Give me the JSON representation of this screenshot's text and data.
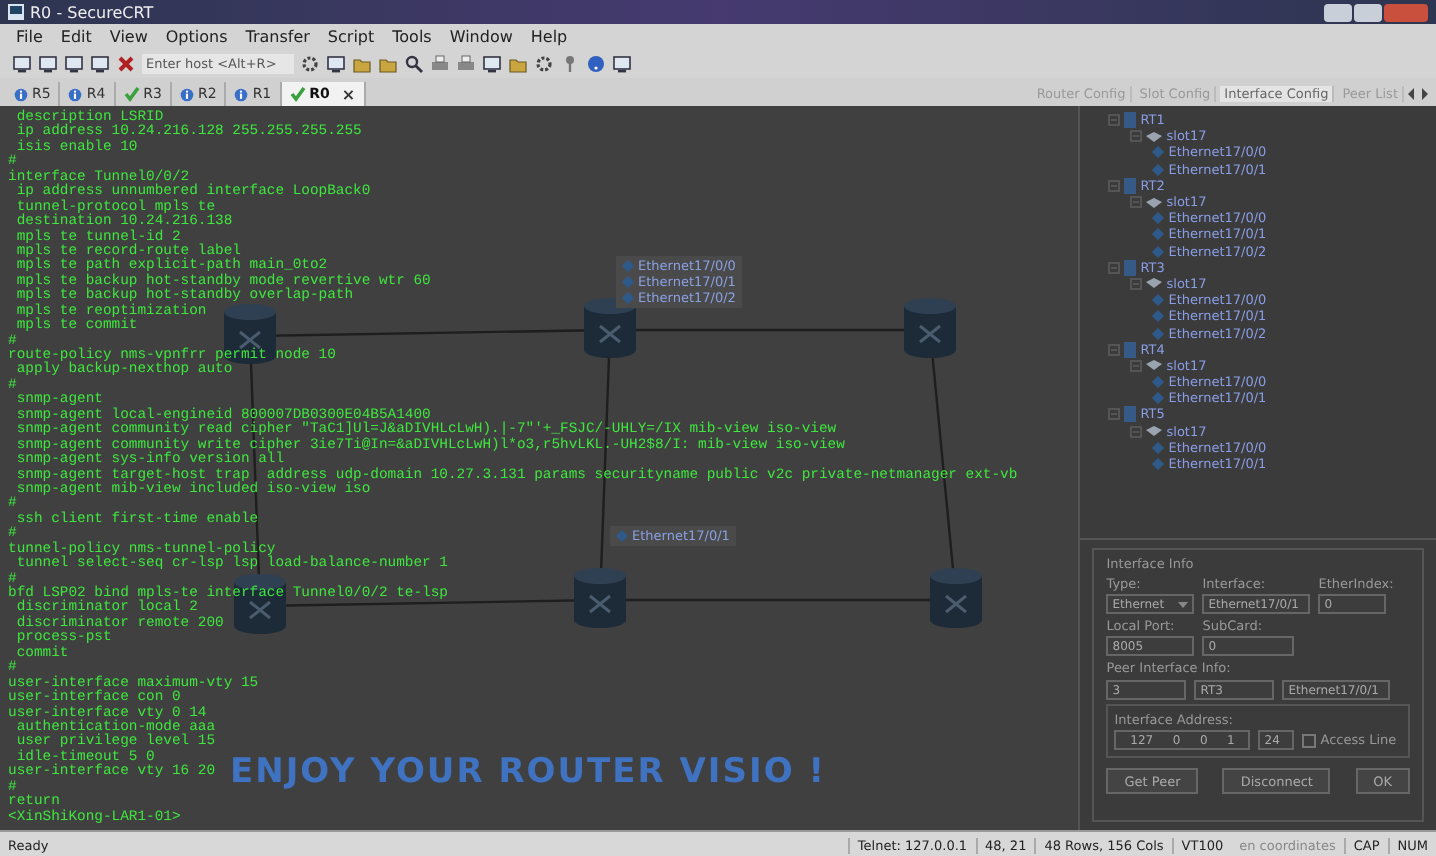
{
  "window": {
    "title": "R0 - SecureCRT"
  },
  "menu": [
    "File",
    "Edit",
    "View",
    "Options",
    "Transfer",
    "Script",
    "Tools",
    "Window",
    "Help"
  ],
  "toolbar": {
    "host_field": {
      "placeholder": "Enter host <Alt+R>"
    }
  },
  "session_tabs": [
    {
      "label": "R5",
      "kind": "info",
      "selected": false
    },
    {
      "label": "R4",
      "kind": "info",
      "selected": false
    },
    {
      "label": "R3",
      "kind": "check",
      "selected": false
    },
    {
      "label": "R2",
      "kind": "info",
      "selected": false
    },
    {
      "label": "R1",
      "kind": "info",
      "selected": false
    },
    {
      "label": "R0",
      "kind": "check",
      "selected": true
    }
  ],
  "close_tab": "×",
  "panel_tabs": [
    {
      "label": "Router Config",
      "selected": false
    },
    {
      "label": "Slot Config",
      "selected": false
    },
    {
      "label": "Interface Config",
      "selected": true
    },
    {
      "label": "Peer List",
      "selected": false
    }
  ],
  "terminal": {
    "lines": [
      " description LSRID",
      " ip address 10.24.216.128 255.255.255.255",
      " isis enable 10",
      "#",
      "interface Tunnel0/0/2",
      " ip address unnumbered interface LoopBack0",
      " tunnel-protocol mpls te",
      " destination 10.24.216.138",
      " mpls te tunnel-id 2",
      " mpls te record-route label",
      " mpls te path explicit-path main_0to2",
      " mpls te backup hot-standby mode revertive wtr 60",
      " mpls te backup hot-standby overlap-path",
      " mpls te reoptimization",
      " mpls te commit",
      "#",
      "route-policy nms-vpnfrr permit node 10",
      " apply backup-nexthop auto",
      "#",
      " snmp-agent",
      " snmp-agent local-engineid 800007DB0300E04B5A1400",
      " snmp-agent community read cipher \"TaC1]Ul=J&aDIVHLcLwH).|-7\"'+_FSJC/-UHLY=/IX mib-view iso-view",
      " snmp-agent community write cipher 3ie7Ti@In=&aDIVHLcLwH)l*o3,r5hvLKL.-UH2$8/I: mib-view iso-view",
      " snmp-agent sys-info version all",
      " snmp-agent target-host trap  address udp-domain 10.27.3.131 params securityname public v2c private-netmanager ext-vb",
      " snmp-agent mib-view included iso-view iso",
      "#",
      " ssh client first-time enable",
      "#",
      "tunnel-policy nms-tunnel-policy",
      " tunnel select-seq cr-lsp lsp load-balance-number 1",
      "#",
      "bfd LSP02 bind mpls-te interface Tunnel0/0/2 te-lsp",
      " discriminator local 2",
      " discriminator remote 200",
      " process-pst",
      " commit",
      "#",
      "user-interface maximum-vty 15",
      "user-interface con 0",
      "user-interface vty 0 14",
      " authentication-mode aaa",
      " user privilege level 15",
      " idle-timeout 5 0",
      "user-interface vty 16 20",
      "#",
      "return",
      "<XinShiKong-LAR1-01>"
    ]
  },
  "diagram": {
    "port_popups": [
      {
        "ports": [
          "Ethernet17/0/0",
          "Ethernet17/0/1",
          "Ethernet17/0/2"
        ]
      },
      {
        "ports": [
          "Ethernet17/0/1"
        ]
      }
    ],
    "banner": "ENJOY YOUR ROUTER VISIO !"
  },
  "device_tree": [
    {
      "label": "RT1",
      "children": [
        {
          "label": "slot17",
          "children": [
            {
              "label": "Ethernet17/0/0"
            },
            {
              "label": "Ethernet17/0/1"
            }
          ]
        }
      ]
    },
    {
      "label": "RT2",
      "children": [
        {
          "label": "slot17",
          "children": [
            {
              "label": "Ethernet17/0/0"
            },
            {
              "label": "Ethernet17/0/1"
            },
            {
              "label": "Ethernet17/0/2"
            }
          ]
        }
      ]
    },
    {
      "label": "RT3",
      "children": [
        {
          "label": "slot17",
          "children": [
            {
              "label": "Ethernet17/0/0"
            },
            {
              "label": "Ethernet17/0/1"
            },
            {
              "label": "Ethernet17/0/2"
            }
          ]
        }
      ]
    },
    {
      "label": "RT4",
      "children": [
        {
          "label": "slot17",
          "children": [
            {
              "label": "Ethernet17/0/0"
            },
            {
              "label": "Ethernet17/0/1"
            }
          ]
        }
      ]
    },
    {
      "label": "RT5",
      "children": [
        {
          "label": "slot17",
          "children": [
            {
              "label": "Ethernet17/0/0"
            },
            {
              "label": "Ethernet17/0/1"
            }
          ]
        }
      ]
    }
  ],
  "interface_info": {
    "title": "Interface Info",
    "type": {
      "label": "Type:",
      "value": "Ethernet"
    },
    "interface": {
      "label": "Interface:",
      "value": "Ethernet17/0/1"
    },
    "ether_index": {
      "label": "EtherIndex:",
      "value": "0"
    },
    "local_port": {
      "label": "Local Port:",
      "value": "8005"
    },
    "sub_card": {
      "label": "SubCard:",
      "value": "0"
    },
    "peer": {
      "label": "Peer Interface Info:",
      "values": [
        "3",
        "RT3",
        "Ethernet17/0/1"
      ]
    },
    "address": {
      "label": "Interface Address:",
      "octets": [
        "127",
        "0",
        "0",
        "1"
      ],
      "mask": "24"
    },
    "access_line": {
      "label": "Access Line",
      "checked": false
    },
    "buttons": [
      "Get Peer",
      "Disconnect",
      "OK"
    ]
  },
  "status_bar": {
    "state": "Ready",
    "connection": "Telnet: 127.0.0.1",
    "cursor": "48, 21",
    "size": "48 Rows, 156 Cols",
    "emulation": "VT100",
    "coordinates": "en coordinates",
    "caps": "CAP",
    "num": "NUM"
  }
}
